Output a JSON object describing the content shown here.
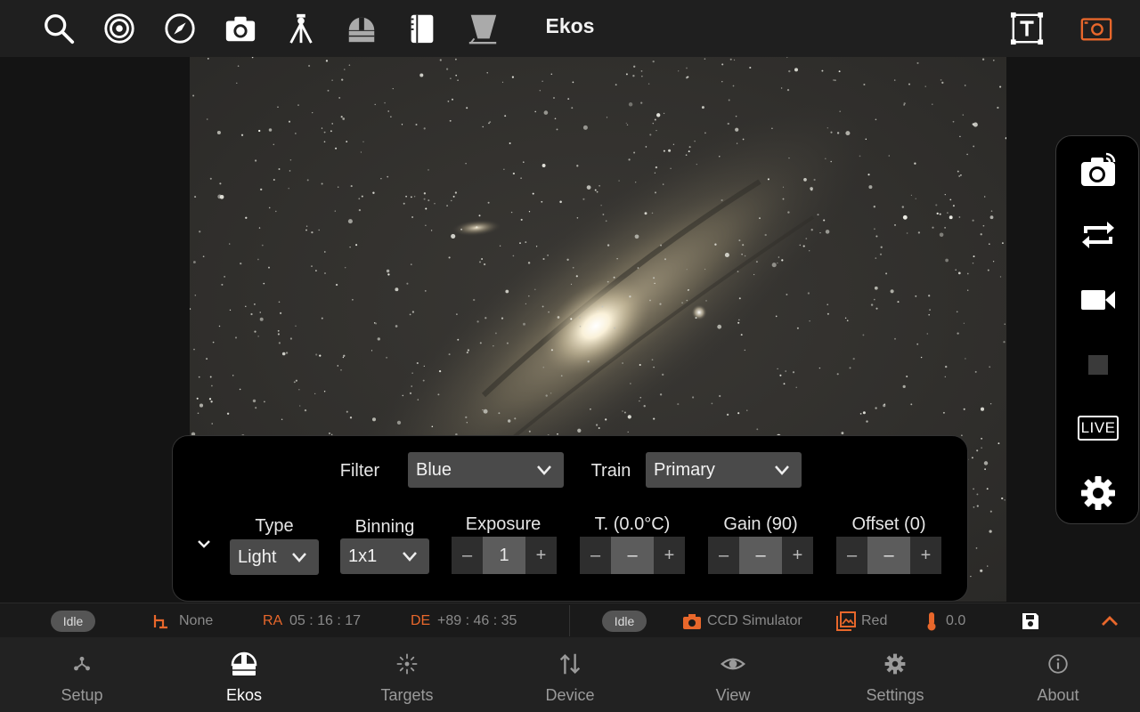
{
  "topbar": {
    "title": "Ekos",
    "icons": [
      "search-icon",
      "target-icon",
      "compass-icon",
      "camera-icon",
      "tripod-icon",
      "dome-icon",
      "notebook-icon",
      "flat-panel-icon"
    ],
    "right_icons": [
      "text-box-icon",
      "camera-frame-icon"
    ]
  },
  "capture_bar": {
    "live_label": "LIVE",
    "buttons": [
      "capture-icon",
      "loop-icon",
      "video-icon",
      "stop-icon",
      "live-icon",
      "settings-icon"
    ]
  },
  "panel": {
    "filter_label": "Filter",
    "filter_value": "Blue",
    "train_label": "Train",
    "train_value": "Primary",
    "type_label": "Type",
    "type_value": "Light",
    "binning_label": "Binning",
    "binning_value": "1x1",
    "exposure_label": "Exposure",
    "exposure_value": "1",
    "temp_label": "T. (0.0°C)",
    "temp_value": "–",
    "gain_label": "Gain (90)",
    "gain_value": "–",
    "offset_label": "Offset (0)",
    "offset_value": "–",
    "minus": "–",
    "plus": "+"
  },
  "status": {
    "mount_state": "Idle",
    "pier_side": "None",
    "ra_label": "RA",
    "ra_value": "05 : 16 : 17",
    "de_label": "DE",
    "de_value": "+89 : 46 : 35",
    "camera_state": "Idle",
    "camera_name": "CCD Simulator",
    "filter_name": "Red",
    "temperature": "0.0"
  },
  "nav": {
    "items": [
      {
        "label": "Setup"
      },
      {
        "label": "Ekos"
      },
      {
        "label": "Targets"
      },
      {
        "label": "Device"
      },
      {
        "label": "View"
      },
      {
        "label": "Settings"
      },
      {
        "label": "About"
      }
    ],
    "active": "Ekos"
  },
  "colors": {
    "accent": "#e8672b",
    "toolbar_bg": "#1f1f1f",
    "panel_bg": "#000000"
  }
}
